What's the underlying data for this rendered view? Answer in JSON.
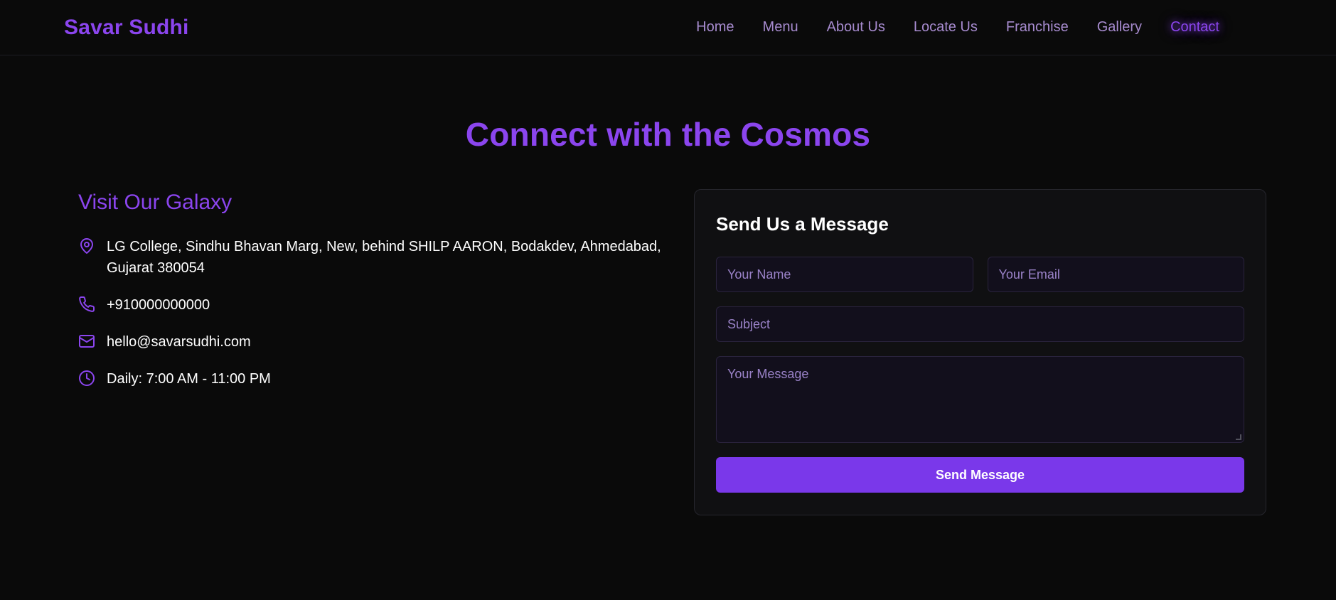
{
  "colors": {
    "accent": "#8b45ee",
    "button": "#7a38ea",
    "background": "#0a0a0a",
    "nav_link": "#a78bcf"
  },
  "navbar": {
    "brand": "Savar Sudhi",
    "links": [
      "Home",
      "Menu",
      "About Us",
      "Locate Us",
      "Franchise",
      "Gallery",
      "Contact"
    ],
    "active": "Contact"
  },
  "hero": {
    "title": "Connect with the Cosmos"
  },
  "info": {
    "heading": "Visit Our Galaxy",
    "address": "LG College, Sindhu Bhavan Marg, New, behind SHILP AARON, Bodakdev, Ahmedabad, Gujarat 380054",
    "phone": "+910000000000",
    "email": "hello@savarsudhi.com",
    "hours": "Daily: 7:00 AM - 11:00 PM",
    "icons": [
      "map-pin-icon",
      "phone-icon",
      "mail-icon",
      "clock-icon"
    ]
  },
  "form": {
    "title": "Send Us a Message",
    "name_placeholder": "Your Name",
    "email_placeholder": "Your Email",
    "subject_placeholder": "Subject",
    "message_placeholder": "Your Message",
    "submit_label": "Send Message"
  }
}
